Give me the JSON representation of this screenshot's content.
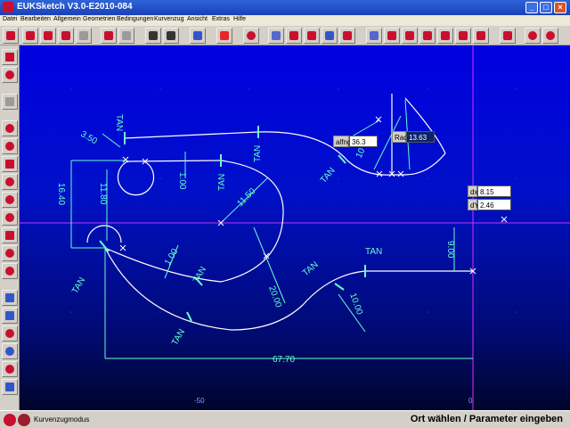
{
  "window": {
    "title": "EUKSketch V3.0-E2010-084"
  },
  "menu": [
    "Datei",
    "Bearbeiten",
    "Allgemein",
    "Geometrien",
    "Bedingungen",
    "Kurvenzug",
    "Ansicht",
    "Extras",
    "Hilfe"
  ],
  "drawing": {
    "dims": {
      "d350": "3.50",
      "d1640": "16.40",
      "d1180": "11.80",
      "d100a": "1.00",
      "d1150": "11.50",
      "d100b": "1.00",
      "d2000": "20.00",
      "d1000a": "10",
      "d1000b": "10.00",
      "d900": "9.00",
      "d6770": "67.70"
    },
    "tan": [
      "TAN",
      "TAN",
      "TAN",
      "TAN",
      "TAN",
      "TAN",
      "TAN",
      "TAN",
      "TAN",
      "TAN"
    ],
    "axis": {
      "x_m50": "-50",
      "x_0": "0"
    },
    "inputs": {
      "angle_label": "alfng",
      "angle_value": "36.3",
      "rad_label": "Rad",
      "rad_value": "13.63",
      "dx_label": "dx",
      "dx_value": "8.15",
      "dy_label": "dY",
      "dy_value": "2.46"
    }
  },
  "status": {
    "mode": "Kurvenzugmodus",
    "prompt": "Ort wählen / Parameter eingeben"
  },
  "colors": {
    "canvas_top": "#0000e0",
    "curve": "#ffffff",
    "dim": "#66ffcc",
    "axis": "#cc33ff"
  }
}
